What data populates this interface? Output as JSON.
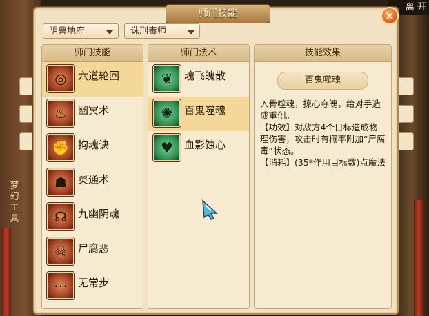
{
  "window": {
    "title": "师门技能",
    "close_glyph": "✕"
  },
  "topbar": {
    "text": "离 开"
  },
  "dropdowns": {
    "school": "阴曹地府",
    "specialty": "诛刑毒师"
  },
  "background_text": {
    "vertical_sign": [
      "梦",
      "幻",
      "工",
      "具"
    ]
  },
  "columns": {
    "skills_header": "师门技能",
    "spells_header": "师门法术",
    "effect_header": "技能效果"
  },
  "skills": [
    {
      "name": "六道轮回",
      "icon": "wheel-icon",
      "selected": true
    },
    {
      "name": "幽冥术",
      "icon": "ghost-icon",
      "selected": false
    },
    {
      "name": "拘魂诀",
      "icon": "fist-icon",
      "selected": false
    },
    {
      "name": "灵通术",
      "icon": "spirit-icon",
      "selected": false
    },
    {
      "name": "九幽阴魂",
      "icon": "souls-icon",
      "selected": false
    },
    {
      "name": "尸腐恶",
      "icon": "skull-icon",
      "selected": false
    },
    {
      "name": "无常步",
      "icon": "footsteps-icon",
      "selected": false
    }
  ],
  "spells": [
    {
      "name": "魂飞魄散",
      "icon": "soul-scatter-icon",
      "selected": false
    },
    {
      "name": "百鬼噬魂",
      "icon": "hundred-ghosts-icon",
      "selected": true
    },
    {
      "name": "血影蚀心",
      "icon": "blood-heart-icon",
      "selected": false
    }
  ],
  "effect": {
    "title": "百鬼噬魂",
    "lines": [
      "入骨噬魂，掠心夺魄，给对手造成重创。",
      "【功效】对敌方4个目标造成物理伤害，攻击时有概率附加“尸腐毒”状态。",
      "【消耗】(35*作用目标数)点魔法"
    ]
  },
  "colors": {
    "selected_row": "#f3d89a",
    "panel": "#f6ead0",
    "frame": "#b08a55",
    "close": "#d0601c"
  }
}
